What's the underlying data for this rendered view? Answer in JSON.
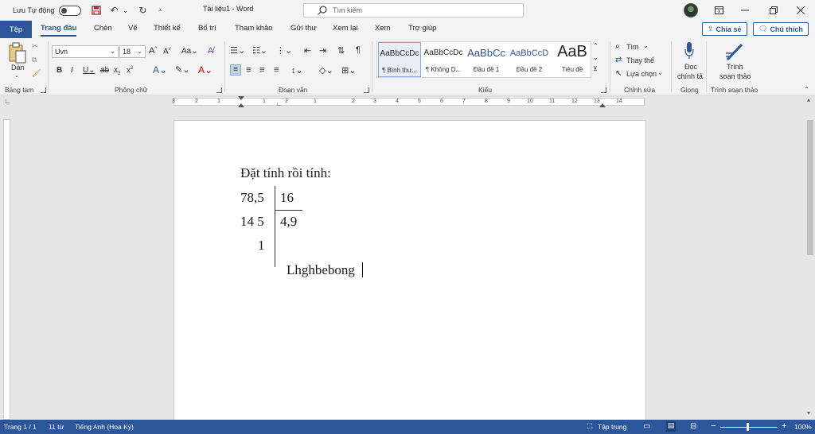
{
  "titlebar": {
    "autosave_label": "Lưu Tự động",
    "doc_title": "Tài liệu1  -  Word",
    "search_placeholder": "Tìm kiếm"
  },
  "tabs": {
    "file": "Tệp",
    "items": [
      "Trang đầu",
      "Chèn",
      "Vẽ",
      "Thiết kế",
      "Bố trí",
      "Tham khảo",
      "Gửi thư",
      "Xem lại",
      "Xem",
      "Trợ giúp"
    ],
    "share": "Chia sẻ",
    "comments": "Chú thích"
  },
  "ribbon": {
    "clipboard": {
      "paste": "Dán",
      "label": "Bảng tạm"
    },
    "font": {
      "name": "Uvn",
      "size": "18",
      "label": "Phông chữ"
    },
    "paragraph": {
      "label": "Đoạn văn"
    },
    "styles": {
      "label": "Kiểu",
      "items": [
        {
          "preview": "AaBbCcDc",
          "name": "¶ Bình thư..."
        },
        {
          "preview": "AaBbCcDc",
          "name": "¶ Không D..."
        },
        {
          "preview": "AaBbCc",
          "name": "Đầu đề 1"
        },
        {
          "preview": "AaBbCcD",
          "name": "Đầu đề 2"
        },
        {
          "preview": "AaB",
          "name": "Tiêu đề"
        }
      ]
    },
    "editing": {
      "find": "Tìm",
      "replace": "Thay thế",
      "select": "Lựa chọn",
      "label": "Chỉnh sửa"
    },
    "voice": {
      "dictate_line1": "Đọc",
      "dictate_line2": "chính tả",
      "label": "Giọng"
    },
    "editor": {
      "line1": "Trình",
      "line2": "soạn thảo",
      "label": "Trình soạn thảo"
    }
  },
  "ruler": {
    "labels": [
      "3",
      "2",
      "1",
      "1",
      "2",
      "1",
      "2",
      "3",
      "4",
      "5",
      "6",
      "7",
      "8",
      "9",
      "10",
      "11",
      "12",
      "13",
      "14",
      "15",
      "17"
    ]
  },
  "document": {
    "heading": "Đặt tính rồi tính:",
    "dividend": "78,5",
    "divisor": "16",
    "remainder1": "14 5",
    "quotient": "4,9",
    "remainder2": "1",
    "extra_text": "Lhghbebong"
  },
  "status": {
    "page": "Trang 1 / 1",
    "words": "11 từ",
    "language": "Tiếng Anh (Hoa Kỳ)",
    "focus": "Tập trung",
    "zoom_minus": "−",
    "zoom_plus": "+",
    "zoom": "100%"
  },
  "colors": {
    "accent": "#2b579a",
    "ribbon_bg": "#f3f3f3"
  }
}
